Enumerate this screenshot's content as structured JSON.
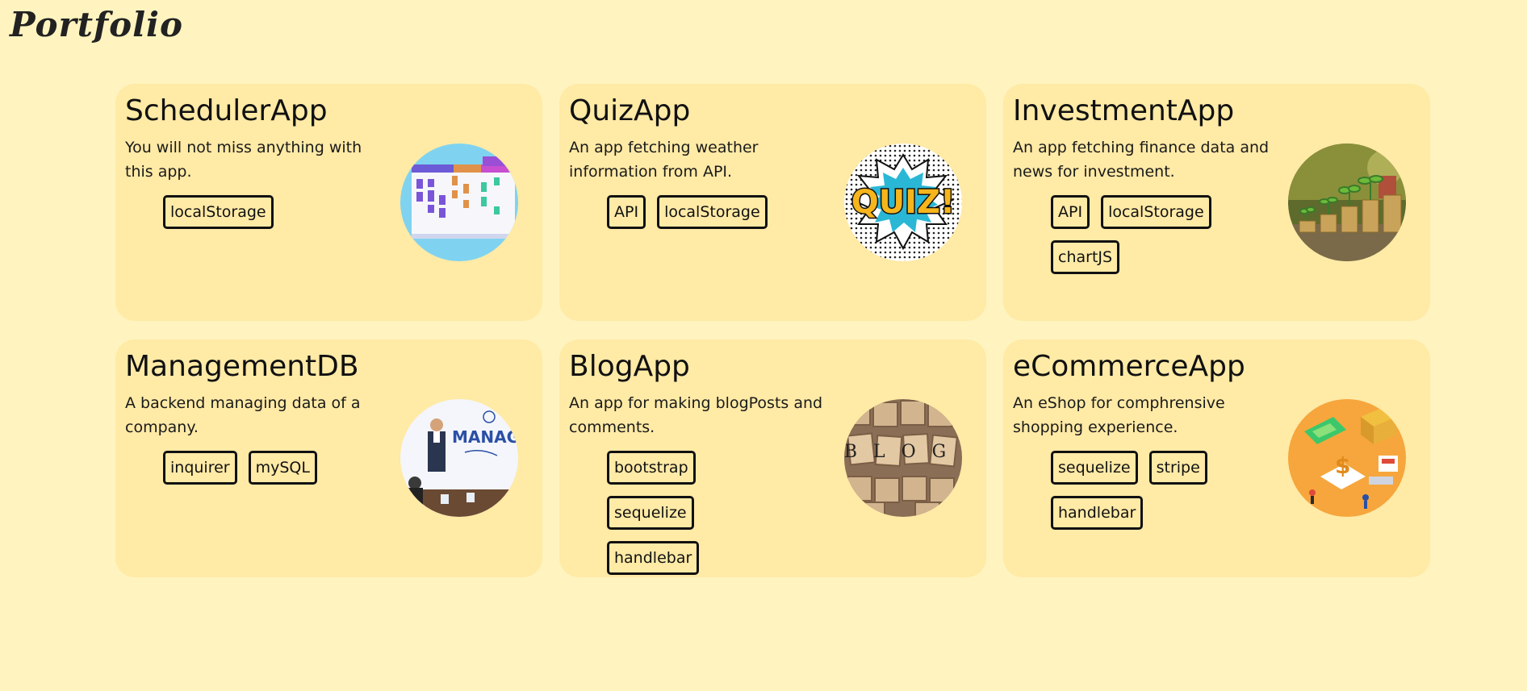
{
  "header": {
    "title": "Portfolio"
  },
  "projects": [
    {
      "title": "SchedulerApp",
      "description": "You will not miss anything with this app.",
      "tags": [
        "localStorage"
      ],
      "image_icon": "calendar-schedule-icon"
    },
    {
      "title": "QuizApp",
      "description": "An app fetching weather information from API.",
      "tags": [
        "API",
        "localStorage"
      ],
      "image_icon": "quiz-comic-icon",
      "image_text": "QUIZ!"
    },
    {
      "title": "InvestmentApp",
      "description": "An app fetching finance data and news for investment.",
      "tags": [
        "API",
        "localStorage",
        "chartJS"
      ],
      "image_icon": "coin-stacks-plants-icon"
    },
    {
      "title": "ManagementDB",
      "description": "A backend managing data of a company.",
      "tags": [
        "inquirer",
        "mySQL"
      ],
      "image_icon": "management-meeting-icon",
      "image_text": "MANAGEM"
    },
    {
      "title": "BlogApp",
      "description": "An app for making blogPosts and comments.",
      "tags": [
        "bootstrap",
        "sequelize",
        "handlebar"
      ],
      "image_icon": "blog-wooden-tiles-icon",
      "image_text": "BLOG"
    },
    {
      "title": "eCommerceApp",
      "description": "An eShop for comphrensive shopping experience.",
      "tags": [
        "sequelize",
        "stripe",
        "handlebar"
      ],
      "image_icon": "ecommerce-isometric-icon"
    }
  ],
  "colors": {
    "background": "#fff4bf",
    "card": "#ffeaa6",
    "tag_border": "#111111"
  }
}
